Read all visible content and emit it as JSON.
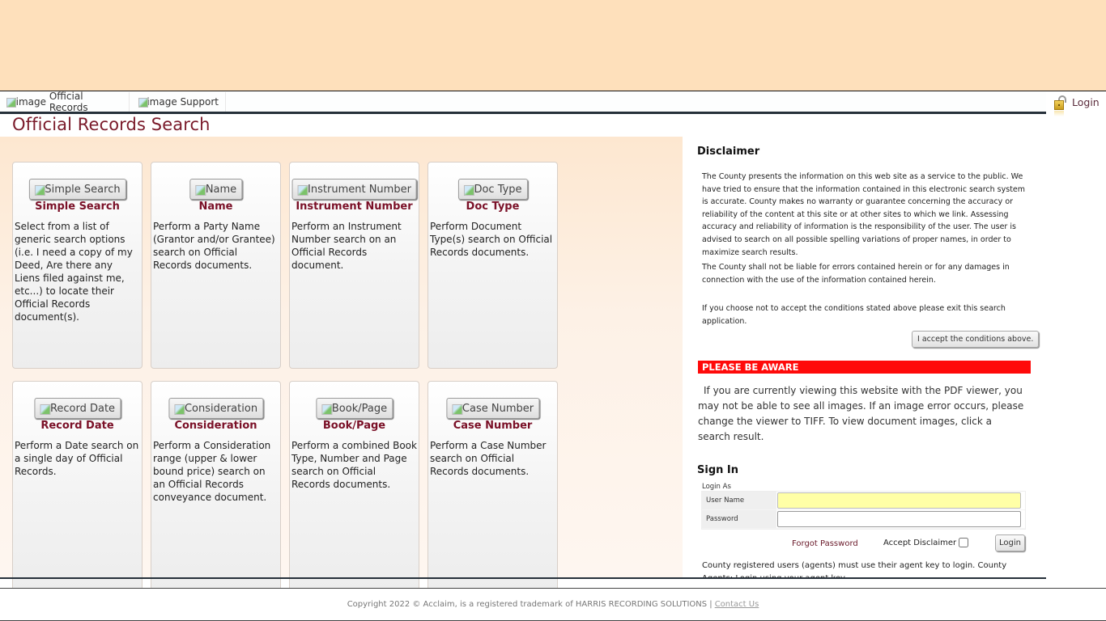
{
  "nav": {
    "items": [
      {
        "alt": "image",
        "label": "Official Records"
      },
      {
        "alt": "image",
        "label": "Support"
      }
    ],
    "login_label": "Login"
  },
  "page": {
    "title": "Official Records Search"
  },
  "cards": [
    {
      "button_alt": "Simple Search",
      "title": "Simple Search",
      "description": "Select from a list of generic search options (i.e. I need a copy of my Deed, Are there any Liens filed against me, etc...) to locate their Official Records document(s)."
    },
    {
      "button_alt": "Name",
      "title": "Name",
      "description": "Perform a Party Name (Grantor and/or Grantee) search on Official Records documents."
    },
    {
      "button_alt": "Instrument Number",
      "title": "Instrument Number",
      "description": "Perform an Instrument Number search on an Official Records document."
    },
    {
      "button_alt": "Doc Type",
      "title": "Doc Type",
      "description": "Perform Document Type(s) search on Official Records documents."
    },
    {
      "button_alt": "Record Date",
      "title": "Record Date",
      "description": "Perform a Date search on a single day of Official Records."
    },
    {
      "button_alt": "Consideration",
      "title": "Consideration",
      "description": "Perform a Consideration range (upper & lower bound price) search on an Official Records conveyance document."
    },
    {
      "button_alt": "Book/Page",
      "title": "Book/Page",
      "description": "Perform a combined Book Type, Number and Page search on Official Records documents."
    },
    {
      "button_alt": "Case Number",
      "title": "Case Number",
      "description": "Perform a Case Number search on Official Records documents."
    }
  ],
  "disclaimer": {
    "title": "Disclaimer",
    "paragraphs": [
      "The County presents the information on this web site as a service to the public. We have tried to ensure that the information contained in this electronic search system is accurate. County makes no warranty or guarantee concerning the accuracy or reliability of the content at this site or at other sites to which we link. Assessing accuracy and reliability of information is the responsibility of the user. The user is advised to search on all possible spelling variations of proper names, in order to maximize search results.",
      "The County shall not be liable for errors contained herein or for any damages in connection with the use of the information contained herein.",
      "If you choose not to accept the conditions stated above please exit this search application."
    ],
    "accept_button": "I accept the conditions above."
  },
  "aware": {
    "heading": "PLEASE BE AWARE",
    "text": "If you are currently viewing this website with the PDF viewer, you may not be able to see all images. If an image error occurs, please change the viewer to TIFF. To view document images, click a search result.",
    "bar_color": "#ff0a0a"
  },
  "signin": {
    "title": "Sign In",
    "login_as": "Login As",
    "username_label": "User Name",
    "username_value": "",
    "password_label": "Password",
    "password_value": "",
    "forgot_password": "Forgot Password",
    "accept_disclaimer": "Accept Disclaimer",
    "accept_disclaimer_checked": false,
    "login_button": "Login",
    "agent_note": "County registered users (agents) must use their agent key to login. County Agents: Login using your agent key."
  },
  "footer": {
    "copyright": "Copyright 2022 © Acclaim, is a registered trademark of HARRIS RECORDING SOLUTIONS |",
    "contact_link": "Contact Us"
  },
  "colors": {
    "banner": "#fee0bb",
    "title_maroon": "#7a1a2a",
    "card_title": "#7a1027",
    "username_highlight": "#ffffa6"
  }
}
